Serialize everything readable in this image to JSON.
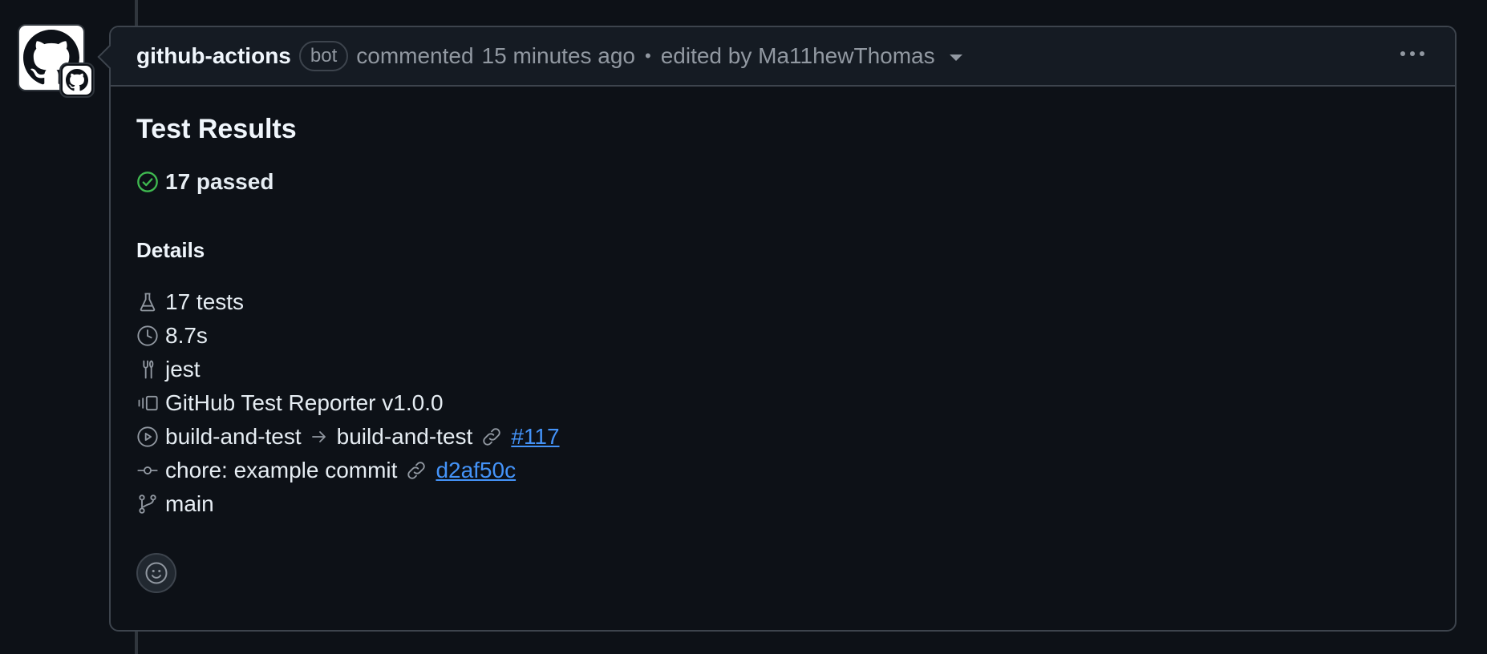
{
  "comment": {
    "author": "github-actions",
    "author_badge": "bot",
    "action": "commented",
    "time": "15 minutes ago",
    "separator": "•",
    "edited_by": "edited by Ma11hewThomas"
  },
  "report": {
    "title": "Test Results",
    "status": "17 passed",
    "details_heading": "Details",
    "tests": "17 tests",
    "duration": "8.7s",
    "tool": "jest",
    "reporter": "GitHub Test Reporter v1.0.0",
    "workflow": "build-and-test",
    "job": "build-and-test",
    "run_link": "#117",
    "commit_message": "chore: example commit",
    "commit_link": "d2af50c",
    "branch": "main"
  },
  "colors": {
    "success": "#3fb950",
    "link": "#4493f8",
    "muted": "#9198a1"
  },
  "icons": [
    "github-logo-icon",
    "check-circle-icon",
    "beaker-icon",
    "clock-icon",
    "tools-icon",
    "versions-icon",
    "play-icon",
    "arrow-right-icon",
    "link-icon",
    "git-commit-icon",
    "git-branch-icon",
    "smiley-icon",
    "kebab-horizontal-icon"
  ]
}
